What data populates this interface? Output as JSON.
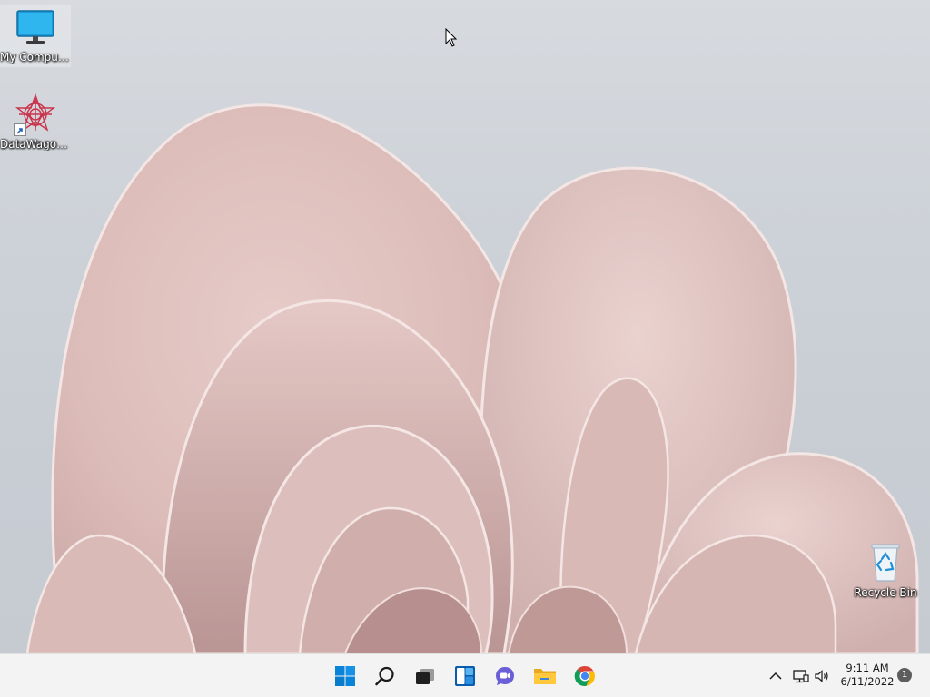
{
  "desktop": {
    "icons": [
      {
        "label": "My Computer",
        "icon": "monitor-icon"
      },
      {
        "label": "DataWagon...",
        "icon": "datawagon-app-icon",
        "shortcut": true
      },
      {
        "label": "Recycle Bin",
        "icon": "recycle-bin-icon"
      }
    ]
  },
  "taskbar": {
    "pinned": [
      {
        "name": "Start",
        "icon": "windows-logo-icon"
      },
      {
        "name": "Search",
        "icon": "search-icon"
      },
      {
        "name": "Task View",
        "icon": "task-view-icon"
      },
      {
        "name": "Widgets",
        "icon": "widgets-icon"
      },
      {
        "name": "Chat",
        "icon": "chat-icon"
      },
      {
        "name": "File Explorer",
        "icon": "folder-icon"
      },
      {
        "name": "Google Chrome",
        "icon": "chrome-icon"
      }
    ],
    "tray": {
      "time": "9:11 AM",
      "date": "6/11/2022",
      "notification_count": "1"
    }
  },
  "colors": {
    "accent": "#0078d4",
    "taskbar_bg": "#f3f3f3",
    "wallpaper_petal": "#e3c6c3"
  }
}
